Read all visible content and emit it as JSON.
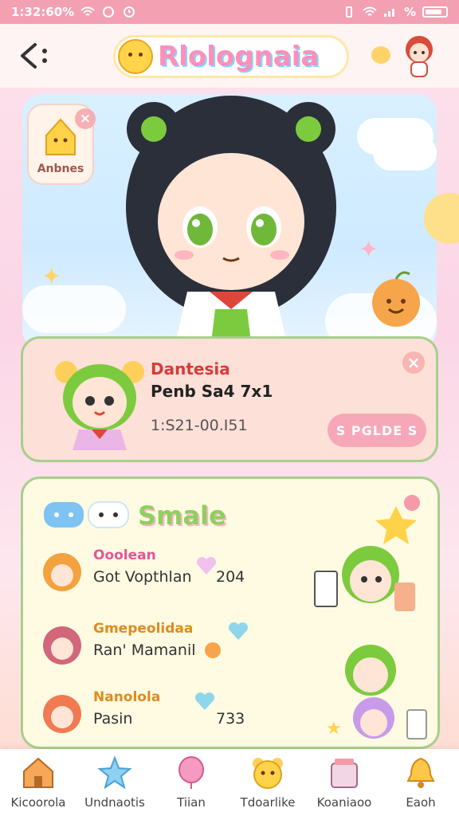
{
  "status_bar": {
    "time": "1:32:60%",
    "battery_text": "%"
  },
  "header": {
    "logo_text": "Rlolognaia"
  },
  "hero": {
    "badge_label": "Anbnes",
    "badge_close": "×"
  },
  "profile_card": {
    "name": "Dantesia",
    "subtitle": "Penb Sa4 7x1",
    "time": "1:S21-00.I51",
    "button_label": "S PGLDE S",
    "close": "×"
  },
  "list_panel": {
    "title": "Smale",
    "rows": [
      {
        "title": "Ooolean",
        "subtitle": "Got Vopthlan",
        "value": "204",
        "title_color": "#e0569a"
      },
      {
        "title": "Gmepeolidaa",
        "subtitle": "Ran' Mamanil",
        "value": "",
        "title_color": "#e08a1f"
      },
      {
        "title": "Nanolola",
        "subtitle": "Pasin",
        "value": "733",
        "title_color": "#e08a1f"
      }
    ]
  },
  "bottom_nav": {
    "items": [
      {
        "label": "Kicoorola",
        "icon": "home-icon"
      },
      {
        "label": "Undnaotis",
        "icon": "star-icon"
      },
      {
        "label": "Tiian",
        "icon": "balloon-icon"
      },
      {
        "label": "Tdoarlike",
        "icon": "bear-icon"
      },
      {
        "label": "Koaniaoo",
        "icon": "basket-icon"
      },
      {
        "label": "Eaoh",
        "icon": "bell-icon"
      }
    ]
  },
  "colors": {
    "accent_pink": "#f7a8b8",
    "border_green": "#a8cf8c",
    "name_red": "#d83a3a"
  }
}
